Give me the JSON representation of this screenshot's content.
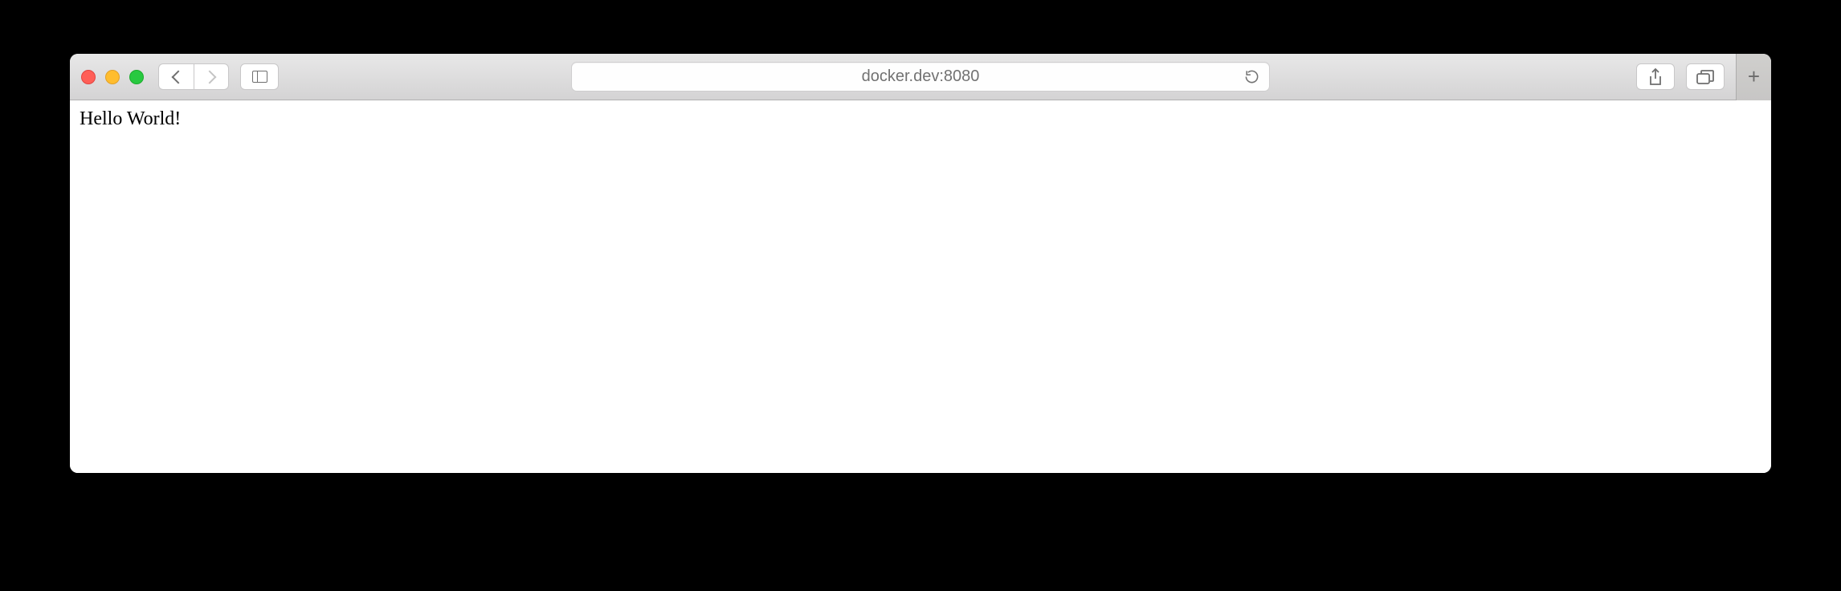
{
  "toolbar": {
    "address": "docker.dev:8080"
  },
  "page": {
    "body_text": "Hello World!"
  }
}
